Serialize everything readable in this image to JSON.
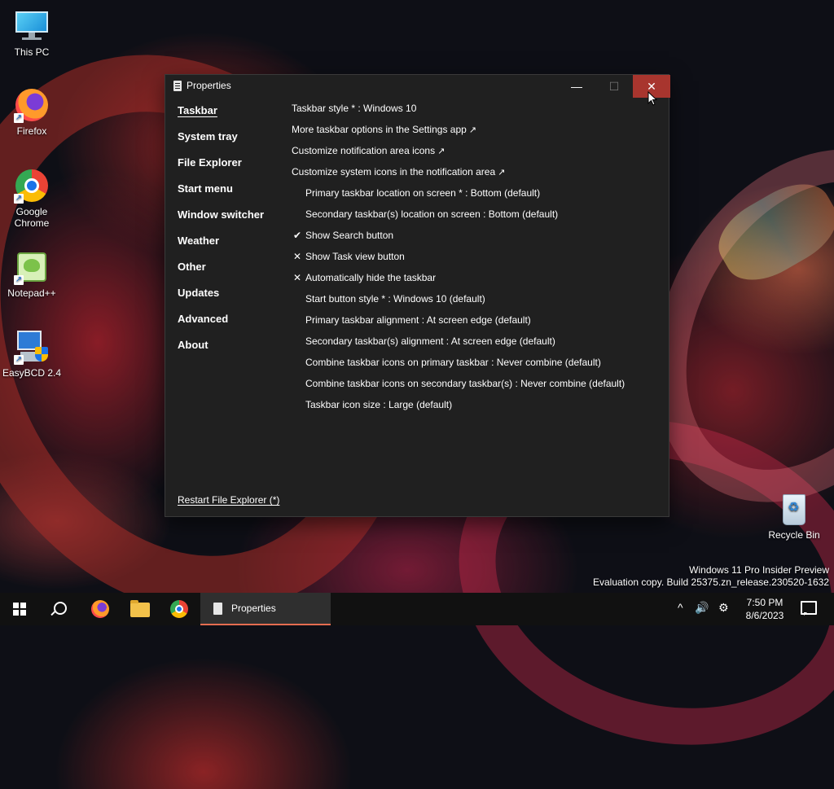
{
  "desktop": {
    "icons": [
      {
        "label": "This PC"
      },
      {
        "label": "Firefox"
      },
      {
        "label": "Google Chrome"
      },
      {
        "label": "Notepad++"
      },
      {
        "label": "EasyBCD 2.4"
      },
      {
        "label": "Recycle Bin"
      }
    ],
    "shortcut_glyph": "↗"
  },
  "window": {
    "title": "Properties",
    "controls": {
      "minimize": "—",
      "maximize": "☐",
      "close": "✕"
    },
    "nav": [
      {
        "label": "Taskbar",
        "active": true
      },
      {
        "label": "System tray"
      },
      {
        "label": "File Explorer"
      },
      {
        "label": "Start menu"
      },
      {
        "label": "Window switcher"
      },
      {
        "label": "Weather"
      },
      {
        "label": "Other"
      },
      {
        "label": "Updates"
      },
      {
        "label": "Advanced"
      },
      {
        "label": "About"
      }
    ],
    "settings": [
      {
        "text": "Taskbar style * : Windows 10"
      },
      {
        "text": "More taskbar options in the Settings app",
        "arrow": "↗"
      },
      {
        "text": "Customize notification area icons",
        "arrow": "↗"
      },
      {
        "text": "Customize system icons in the notification area",
        "arrow": "↗"
      },
      {
        "text": "Primary taskbar location on screen * : Bottom (default)"
      },
      {
        "text": "Secondary taskbar(s) location on screen : Bottom (default)"
      },
      {
        "text": "Show Search button",
        "mark": "✔"
      },
      {
        "text": "Show Task view button",
        "mark": "✕"
      },
      {
        "text": "Automatically hide the taskbar",
        "mark": "✕"
      },
      {
        "text": "Start button style * : Windows 10 (default)"
      },
      {
        "text": "Primary taskbar alignment : At screen edge (default)"
      },
      {
        "text": "Secondary taskbar(s) alignment : At screen edge (default)"
      },
      {
        "text": "Combine taskbar icons on primary taskbar : Never combine (default)"
      },
      {
        "text": "Combine taskbar icons on secondary taskbar(s) : Never combine (default)"
      },
      {
        "text": "Taskbar icon size : Large (default)"
      }
    ],
    "restart_link": "Restart File Explorer (*)"
  },
  "watermark": {
    "line1": "Windows 11 Pro Insider Preview",
    "line2": "Evaluation copy. Build 25375.zn_release.230520-1632"
  },
  "taskbar": {
    "active_task_label": "Properties",
    "tray": {
      "chevron": "^",
      "volume": "🔊",
      "settings": "⚙"
    },
    "time": "7:50 PM",
    "date": "8/6/2023"
  },
  "colors": {
    "close_hover": "#a8352e",
    "window_bg": "#202020",
    "taskbar_bg": "#111111",
    "task_underline": "#e56d50"
  }
}
